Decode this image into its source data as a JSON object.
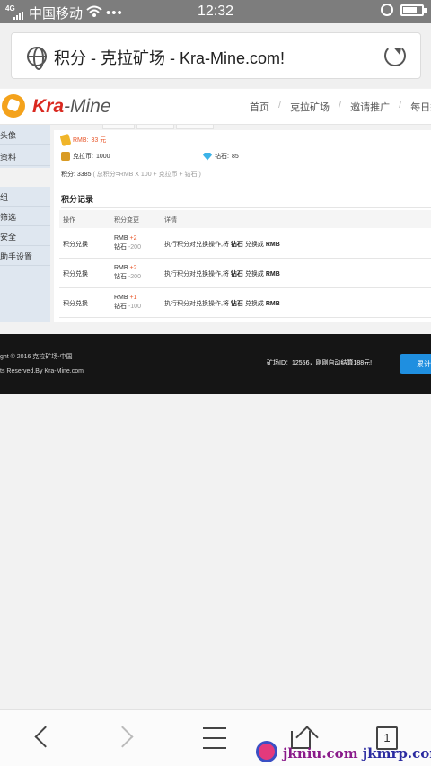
{
  "status_bar": {
    "carrier": "中国移动",
    "dots": "•••",
    "time": "12:32",
    "network": "4G",
    "battery_level": 0.75
  },
  "browser": {
    "url_title": "积分 - 克拉矿场 - Kra-Mine.com!"
  },
  "site": {
    "logo_part1": "Kra",
    "logo_part2": "-Mine",
    "nav": [
      "首页",
      "克拉矿场",
      "邀请推广",
      "每日签"
    ]
  },
  "sidebar": {
    "group1": [
      "头像",
      "资料"
    ],
    "group2": [
      "组",
      "筛选",
      "安全",
      "助手设置"
    ]
  },
  "account": {
    "rmb_label": "RMB:",
    "rmb_value": "33 元",
    "coin_label": "克拉币:",
    "coin_value": "1000",
    "diamond_label": "钻石:",
    "diamond_value": "85",
    "points_label": "积分:",
    "points_value": "3385",
    "points_note": "( 总积分=RMB X 100 + 克拉币 + 钻石 )"
  },
  "records": {
    "title": "积分记录",
    "headers": [
      "操作",
      "积分变更",
      "详情"
    ],
    "rows": [
      {
        "op": "积分兑换",
        "rmb_label": "RMB",
        "rmb_change": "+2",
        "dia_label": "钻石",
        "dia_change": "-200",
        "detail_pre": "执行积分对兑换操作,将",
        "detail_from": "钻石",
        "detail_mid": "兑换成",
        "detail_to": "RMB"
      },
      {
        "op": "积分兑换",
        "rmb_label": "RMB",
        "rmb_change": "+2",
        "dia_label": "钻石",
        "dia_change": "-200",
        "detail_pre": "执行积分对兑换操作,将",
        "detail_from": "钻石",
        "detail_mid": "兑换成",
        "detail_to": "RMB"
      },
      {
        "op": "积分兑换",
        "rmb_label": "RMB",
        "rmb_change": "+1",
        "dia_label": "钻石",
        "dia_change": "-100",
        "detail_pre": "执行积分对兑换操作,将",
        "detail_from": "钻石",
        "detail_mid": "兑换成",
        "detail_to": "RMB"
      }
    ]
  },
  "footer": {
    "copyright": "ght © 2016  克拉矿场-中国",
    "rights": "ts Reserved.By   Kra-Mine.com",
    "mine_info": "矿场ID：12556，刚刚自动结算188元!",
    "button": "累计"
  },
  "toolbar": {
    "tab_count": "1"
  },
  "watermark": {
    "text1": "jkniu.com",
    "text2": "jkmrp.com"
  },
  "colors": {
    "accent_orange": "#e8572a",
    "footer_bg": "#151515",
    "button_blue": "#1f8fe0",
    "sidebar_bg": "#dfe7f0"
  }
}
